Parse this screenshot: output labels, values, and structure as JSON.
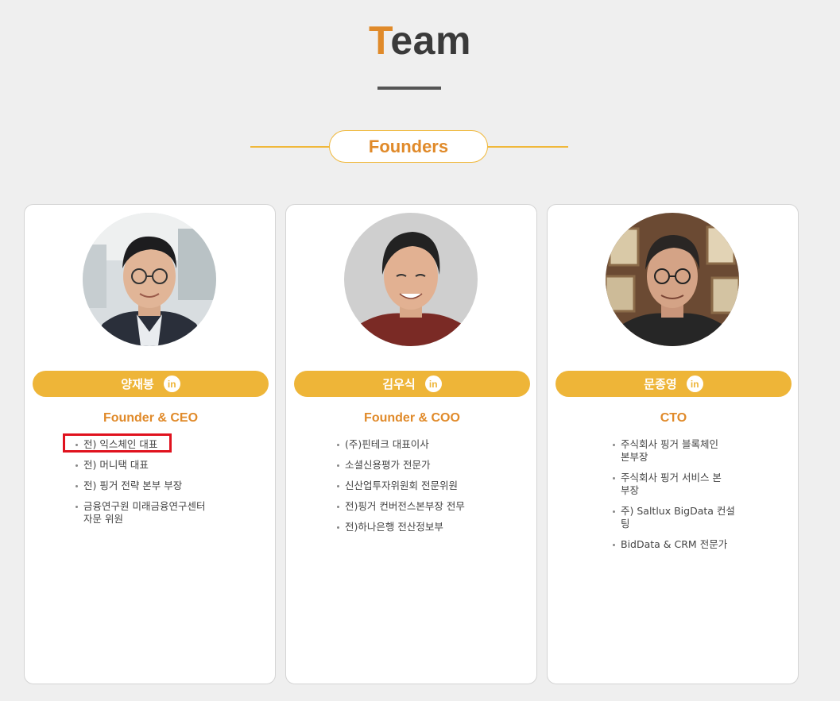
{
  "header": {
    "title_first": "T",
    "title_rest": "eam",
    "section": "Founders"
  },
  "colors": {
    "accent": "#e08a2a",
    "bar": "#eeb538",
    "highlight": "#e0121e"
  },
  "members": [
    {
      "name": "양재봉",
      "role": "Founder & CEO",
      "bullets": [
        "전) 익스체인 대표",
        "전) 머니택 대표",
        "전) 핑거 전략 본부 부장",
        "금융연구원 미래금융연구센터\n자문 위원"
      ]
    },
    {
      "name": "김우식",
      "role": "Founder & COO",
      "bullets": [
        "(주)핀테크 대표이사",
        "소셜신용평가 전문가",
        "신산업투자위원회 전문위원",
        "전)핑거 컨버전스본부장 전무",
        "전)하나은행 전산정보부"
      ]
    },
    {
      "name": "문종영",
      "role": "CTO",
      "bullets": [
        "주식회사 핑거 블록체인\n본부장",
        "주식회사 핑거 서비스 본\n부장",
        "주) Saltlux BigData 컨설\n팅",
        "BidData & CRM 전문가"
      ]
    }
  ],
  "icons": {
    "linkedin": "in"
  }
}
